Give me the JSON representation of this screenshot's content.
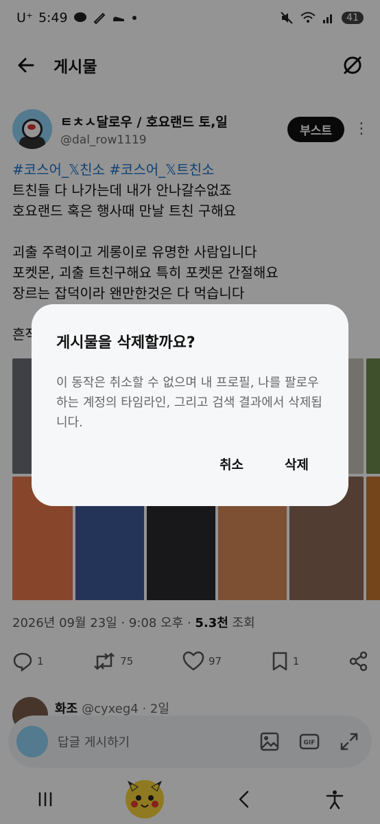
{
  "status_bar": {
    "time": "5:49",
    "carrier": "U⁺",
    "battery": "41",
    "icons": [
      "talk-icon",
      "pen-icon",
      "shoe-icon",
      "dot-icon",
      "mute-icon",
      "wifi-icon",
      "signal-icon"
    ]
  },
  "top_bar": {
    "title": "게시물"
  },
  "post": {
    "display_name": "ㅌㅊㅅ달로우 / 호요랜드 토,일",
    "handle": "@dal_row1119",
    "boost_label": "부스트",
    "hashtags": "#코스어_𝕏친소 #코스어_𝕏트친소",
    "lines": [
      "트친들 다 나가는데 내가 안나갈수없죠",
      "호요랜드 혹은 행사때 만날 트친 구해요",
      "",
      "괴출 주력이고 게롱이로 유명한 사람입니다",
      "포켓몬, 괴출 트친구해요 특히 포켓몬 간절해요",
      "장르는 잡덕이라 왠만한것은 다 먹습니다",
      "",
      "흔적"
    ],
    "timestamp": "2026년 09월 23일 · 9:08 오후 · ",
    "views_count": "5.3천",
    "views_label": " 조회",
    "actions": {
      "replies": "1",
      "reposts": "75",
      "likes": "97",
      "bookmarks": "1"
    }
  },
  "reply_preview": {
    "name": "화조",
    "meta": "@cyxeg4 · 2일"
  },
  "composer": {
    "placeholder": "답글 게시하기"
  },
  "dialog": {
    "title": "게시물을 삭제할까요?",
    "body": "이 동작은 취소할 수 없으며 내 프로필, 나를 팔로우하는 계정의 타임라인, 그리고 검색 결과에서 삭제됩니다.",
    "cancel": "취소",
    "confirm": "삭제"
  },
  "colors": {
    "accent": "#1d73c9",
    "scrim": "rgba(0,0,0,0.42)",
    "dialog_bg": "#f6f7f9"
  }
}
